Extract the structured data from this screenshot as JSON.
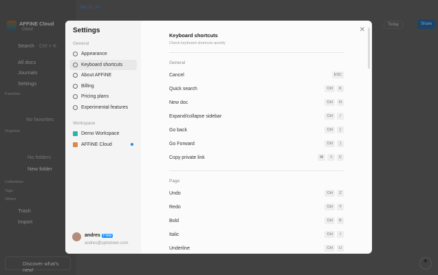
{
  "app": {
    "workspace_name": "AFFiNE Cloud",
    "workspace_sub": "Cloud",
    "search_label": "Search",
    "search_shortcut": "Ctrl + K",
    "nav": [
      "All docs",
      "Journals",
      "Settings"
    ],
    "favorites": "Favorites",
    "no_favorites": "No favorites",
    "organize": "Organize",
    "no_folders": "No folders",
    "new_folder": "New folder",
    "collections": "Collections",
    "tags": "Tags",
    "others": "Others",
    "trash": "Trash",
    "import": "Import",
    "discover": "Discover what's new!",
    "tab_label": "Sep 17, 20",
    "today": "Today",
    "share": "Share"
  },
  "settings": {
    "title": "Settings",
    "general_label": "General",
    "general_items": [
      {
        "label": "Appearance",
        "icon": "palette-icon"
      },
      {
        "label": "Keyboard shortcuts",
        "icon": "keyboard-icon",
        "active": true
      },
      {
        "label": "About AFFiNE",
        "icon": "info-icon"
      },
      {
        "label": "Billing",
        "icon": "card-icon"
      },
      {
        "label": "Pricing plans",
        "icon": "plan-icon"
      },
      {
        "label": "Experimental features",
        "icon": "flask-icon"
      }
    ],
    "workspace_label": "Workspace",
    "workspaces": [
      {
        "label": "Demo Workspace",
        "color": "#2bb5a8"
      },
      {
        "label": "AFFiNE Cloud",
        "color": "#d68a4a",
        "dot": true
      }
    ],
    "user": {
      "name": "andres",
      "badge": "Free",
      "email": "andres@uptodown.com"
    }
  },
  "shortcuts": {
    "title": "Keyboard shortcuts",
    "subtitle": "Check keyboard shortcuts quickly",
    "groups": [
      {
        "name": "General",
        "items": [
          {
            "label": "Cancel",
            "keys": [
              "ESC"
            ]
          },
          {
            "label": "Quick search",
            "keys": [
              "Ctrl",
              "K"
            ]
          },
          {
            "label": "New doc",
            "keys": [
              "Ctrl",
              "N"
            ]
          },
          {
            "label": "Expand/collapse sidebar",
            "keys": [
              "Ctrl",
              "/"
            ]
          },
          {
            "label": "Go back",
            "keys": [
              "Ctrl",
              "["
            ]
          },
          {
            "label": "Go Forward",
            "keys": [
              "Ctrl",
              "]"
            ]
          },
          {
            "label": "Copy private link",
            "keys": [
              "⌘",
              "⇧",
              "C"
            ]
          }
        ]
      },
      {
        "name": "Page",
        "items": [
          {
            "label": "Undo",
            "keys": [
              "Ctrl",
              "Z"
            ]
          },
          {
            "label": "Redo",
            "keys": [
              "Ctrl",
              "Y"
            ]
          },
          {
            "label": "Bold",
            "keys": [
              "Ctrl",
              "B"
            ]
          },
          {
            "label": "Italic",
            "keys": [
              "Ctrl",
              "I"
            ]
          },
          {
            "label": "Underline",
            "keys": [
              "Ctrl",
              "U"
            ]
          }
        ]
      }
    ]
  }
}
